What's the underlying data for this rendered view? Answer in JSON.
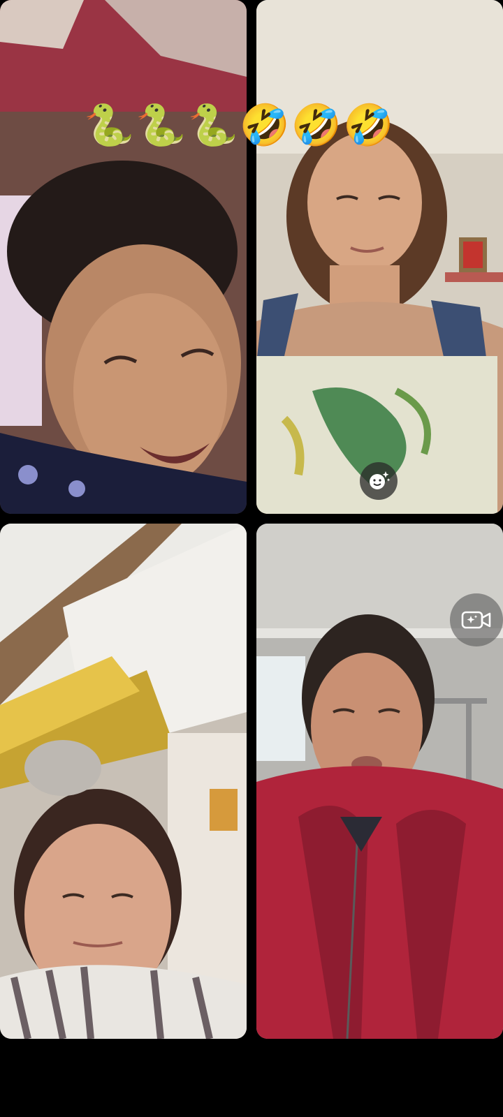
{
  "call": {
    "reaction_emojis": [
      "🐍",
      "🐍",
      "🐍",
      "🤣",
      "🤣",
      "🤣"
    ]
  },
  "participants": [
    {
      "tile": "participant-video-1",
      "bg": "#7c5a4c"
    },
    {
      "tile": "participant-video-2",
      "bg": "#d8d0c2"
    },
    {
      "tile": "participant-video-3",
      "bg": "#c9bfb2"
    },
    {
      "tile": "participant-video-4",
      "bg": "#b9b7b2"
    }
  ],
  "icons": {
    "effects": "face-sparkle-icon",
    "camera_effects": "video-sparkle-icon"
  },
  "colors": {
    "background": "#000000",
    "jacket_red": "#b0243b",
    "overlay_button": "#2a2a2a"
  }
}
